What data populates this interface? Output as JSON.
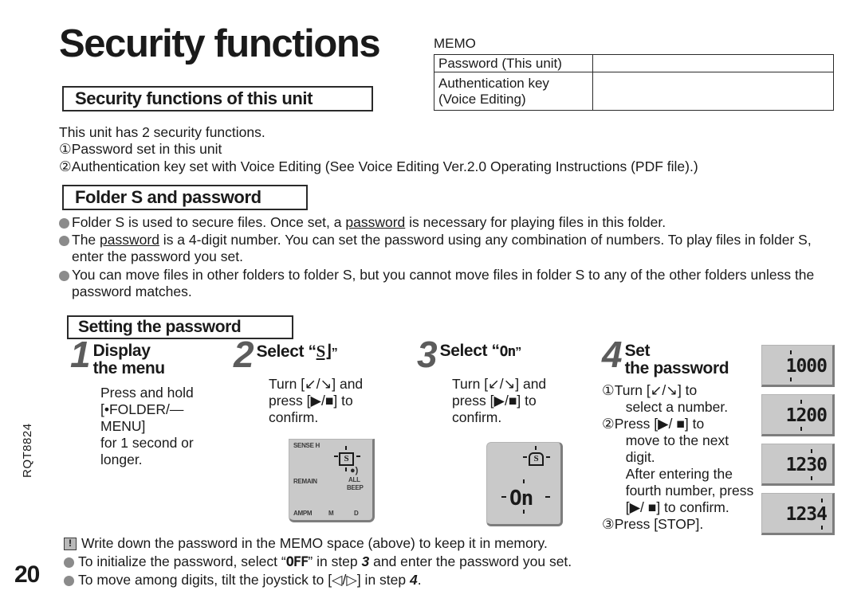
{
  "page": {
    "number": "20",
    "doc_code": "RQT8824",
    "title": "Security functions"
  },
  "memo": {
    "label": "MEMO",
    "rows": [
      {
        "key": "Password (This unit)",
        "value": ""
      },
      {
        "key": "Authentication key\n(Voice Editing)",
        "key_line1": "Authentication key",
        "key_line2": "(Voice Editing)",
        "value": ""
      }
    ]
  },
  "sections": {
    "security": {
      "heading": "Security functions of this unit",
      "lines": [
        "This unit has 2 security functions.",
        "①Password set in this unit",
        "②Authentication key set with Voice Editing (See Voice Editing Ver.2.0 Operating Instructions (PDF file).)"
      ]
    },
    "folder": {
      "heading": "Folder S and password",
      "bullets": [
        {
          "pre": "Folder S is used to secure files. Once set, a ",
          "underlined": "password",
          "post": " is necessary for playing files in this folder."
        },
        {
          "pre": "The ",
          "underlined": "password",
          "post": " is a 4-digit number. You can set the password using any combination of numbers. To play files in folder S, enter the password you set."
        },
        {
          "pre": "You can move files in other folders to folder S, but you cannot move files in folder S to any of the other folders unless the password matches.",
          "underlined": "",
          "post": ""
        }
      ]
    },
    "setting": {
      "heading": "Setting the password"
    }
  },
  "steps": [
    {
      "number": "1",
      "title_line1": "Display",
      "title_line2": "the menu",
      "body_lines": [
        "Press and hold",
        "[•FOLDER/— MENU]",
        "for 1 second or",
        "longer."
      ]
    },
    {
      "number": "2",
      "title_prefix": "Select “",
      "title_symbol": "S⌋",
      "title_suffix": "”",
      "body_lines": [
        "Turn [↙/↘] and",
        "press [▶/■] to",
        "confirm."
      ]
    },
    {
      "number": "3",
      "title_prefix": "Select “",
      "title_symbol": "On",
      "title_suffix": "”",
      "body_lines": [
        "Turn [↙/↘] and",
        "press [▶/■] to",
        "confirm."
      ]
    },
    {
      "number": "4",
      "title_line1": "Set",
      "title_line2": "the password",
      "sub_items": [
        {
          "marker": "①",
          "lines": [
            "Turn [↙/↘] to",
            "select a number."
          ]
        },
        {
          "marker": "②",
          "lines": [
            "Press [▶/ ■] to",
            "move to the next digit.",
            "After entering the",
            "fourth number, press",
            "[▶/ ■] to confirm."
          ]
        },
        {
          "marker": "③",
          "lines": [
            "Press [STOP]."
          ]
        }
      ]
    }
  ],
  "lcd": {
    "step2": {
      "label_sense": "SENSE H",
      "label_remain": "REMAIN",
      "label_all": "ALL",
      "label_beep": "BEEP",
      "label_ampm": "AMPM",
      "label_m": "M",
      "label_d": "D",
      "badge": "S"
    },
    "step3": {
      "badge": "S",
      "value": "On"
    },
    "password_screens": [
      {
        "digits": "1000",
        "blink_index": 0
      },
      {
        "digits": "1200",
        "blink_index": 1
      },
      {
        "digits": "1230",
        "blink_index": 2
      },
      {
        "digits": "1234",
        "blink_index": 3
      }
    ]
  },
  "notes": [
    {
      "icon": "!",
      "type": "warning",
      "text": "Write down the password in the MEMO space (above) to keep it in memory."
    },
    {
      "icon": "bullet",
      "type": "bullet",
      "pre": "To initialize the password, select “",
      "lcd_value": "OFF",
      "mid": "” in step ",
      "step_ref": "3",
      "post": " and enter the password you set."
    },
    {
      "icon": "bullet",
      "type": "bullet",
      "pre": "To move among digits, tilt the joystick to [◁/▷] in step ",
      "lcd_value": "",
      "mid": "",
      "step_ref": "4",
      "post": "."
    }
  ],
  "colors": {
    "text": "#1a1a1a",
    "step_number": "#5c5c5c",
    "bullet_dot": "#8b8b8b",
    "lcd_bg": "#c9c9c9",
    "lcd_shadow": "#7d7d7d"
  }
}
